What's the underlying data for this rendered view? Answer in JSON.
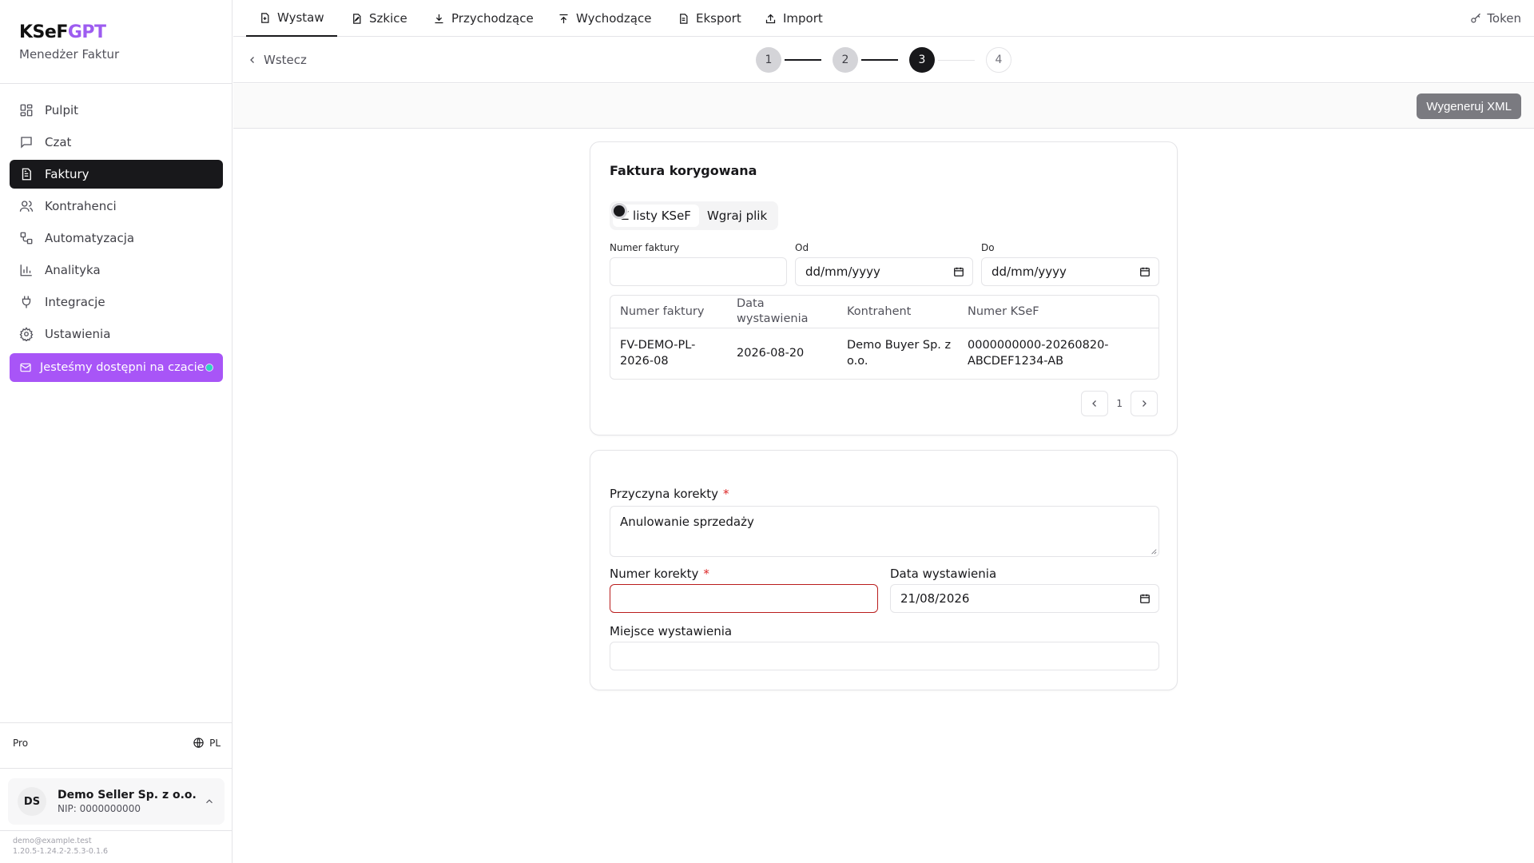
{
  "brand": {
    "logo_a": "KSeF",
    "logo_b": "GPT",
    "subtitle": "Menedżer Faktur"
  },
  "sidebar": {
    "items": [
      {
        "label": "Pulpit",
        "icon": "dashboard-icon"
      },
      {
        "label": "Czat",
        "icon": "chat-icon"
      },
      {
        "label": "Faktury",
        "icon": "invoice-icon",
        "active": true
      },
      {
        "label": "Kontrahenci",
        "icon": "users-icon"
      },
      {
        "label": "Automatyzacja",
        "icon": "workflow-icon"
      },
      {
        "label": "Analityka",
        "icon": "chart-icon"
      },
      {
        "label": "Integracje",
        "icon": "plug-icon"
      },
      {
        "label": "Ustawienia",
        "icon": "gear-icon"
      }
    ],
    "promo": "Jesteśmy dostępni na czacie",
    "plan": "Pro",
    "language": "PL",
    "user": {
      "initials": "DS",
      "name": "Demo Seller Sp. z o.o.",
      "nip": "NIP: 0000000000"
    },
    "email": "demo@example.test",
    "version": "1.20.5-1.24.2-2.5.3-0.1.6"
  },
  "topbar": {
    "tabs": [
      {
        "label": "Wystaw",
        "icon": "file-plus-icon"
      },
      {
        "label": "Szkice",
        "icon": "draft-icon"
      },
      {
        "label": "Przychodzące",
        "icon": "download-icon"
      },
      {
        "label": "Wychodzące",
        "icon": "upload-icon"
      },
      {
        "label": "Eksport",
        "icon": "export-icon"
      },
      {
        "label": "Import",
        "icon": "import-icon"
      }
    ],
    "token": "Token"
  },
  "steps": {
    "back": "Wstecz",
    "items": [
      "1",
      "2",
      "3",
      "4"
    ],
    "current": 3
  },
  "actions": {
    "generate_xml": "Wygeneruj XML"
  },
  "corrected_invoice": {
    "title": "Faktura korygowana",
    "source_options": [
      "Z listy KSeF",
      "Wgraj plik"
    ],
    "filters": {
      "number_label": "Numer faktury",
      "from_label": "Od",
      "from_value": "dd/mm/yyyy",
      "to_label": "Do",
      "to_value": "dd/mm/yyyy"
    },
    "table": {
      "headers": {
        "number": "Numer faktury",
        "date_line1": "Data",
        "date_line2": "wystawienia",
        "contractor": "Kontrahent",
        "ksef": "Numer KSeF"
      },
      "row": {
        "number_line1": "FV-DEMO-PL-",
        "number_line2": "2026-08",
        "date": "2026-08-20",
        "contractor_line1": "Demo Buyer Sp. z",
        "contractor_line2": "o.o.",
        "ksef_line1": "0000000000-20260820-",
        "ksef_line2": "ABCDEF1234-AB"
      }
    },
    "page": "1"
  },
  "correction": {
    "reason_label": "Przyczyna korekty",
    "reason_value": "Anulowanie sprzedaży",
    "number_label": "Numer korekty",
    "number_value": "",
    "date_label": "Data wystawienia",
    "date_value": "21/08/2026",
    "place_label": "Miejsce wystawienia",
    "place_value": "",
    "required_mark": "*"
  }
}
